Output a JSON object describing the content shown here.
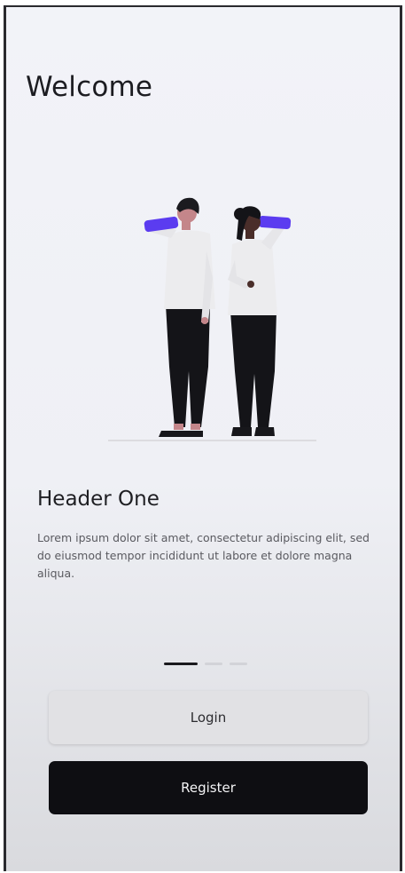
{
  "welcome": {
    "title": "Welcome"
  },
  "onboarding": {
    "illustration": "two-people-drinking-illustration",
    "header": "Header One",
    "body": "Lorem ipsum dolor sit amet, consectetur adipiscing elit, sed do eiusmod tempor incididunt ut labore et dolore magna aliqua.",
    "page_count": 3,
    "current_page": 1
  },
  "actions": {
    "login_label": "Login",
    "register_label": "Register"
  },
  "colors": {
    "accent": "#5b3cf0",
    "background": "#f2f3f8",
    "primary_button": "#0e0e12",
    "secondary_button": "#e1e1e4"
  }
}
